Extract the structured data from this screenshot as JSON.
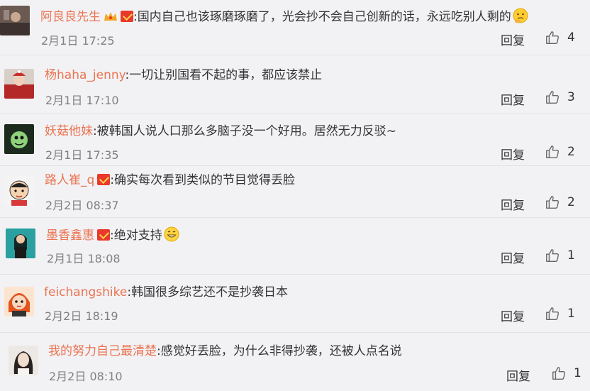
{
  "comments": [
    {
      "username": "阿良良先生",
      "colon": ":",
      "text": "国内自己也该琢磨琢磨了，光会抄不会自己创新的话，永远吃别人剩的",
      "time": "2月1日 17:25",
      "reply": "回复",
      "likes": "4",
      "avatar_icon": "avatar-photo-icon",
      "badges": [
        "crown-icon",
        "red-envelope-icon"
      ],
      "trailing_emoji": "thinking-face-icon"
    },
    {
      "username": "杨haha_jenny",
      "colon": ":",
      "text": "一切让别国看不起的事，都应该禁止",
      "time": "2月1日 17:10",
      "reply": "回复",
      "likes": "3",
      "avatar_icon": "avatar-photo-icon",
      "badges": [],
      "trailing_emoji": ""
    },
    {
      "username": "妖菇他妹",
      "colon": ":",
      "text": "被韩国人说人口那么多脑子没一个好用。居然无力反驳~",
      "time": "2月1日 17:35",
      "reply": "回复",
      "likes": "2",
      "avatar_icon": "avatar-photo-icon",
      "badges": [],
      "trailing_emoji": ""
    },
    {
      "username": "路人崔_q",
      "colon": ":",
      "text": "确实每次看到类似的节目觉得丢脸",
      "time": "2月2日 08:37",
      "reply": "回复",
      "likes": "2",
      "avatar_icon": "avatar-cartoon-icon",
      "badges": [
        "red-envelope-icon"
      ],
      "trailing_emoji": ""
    },
    {
      "username": "墨香鑫惠",
      "colon": ":",
      "text": "绝对支持",
      "time": "2月1日 18:08",
      "reply": "回复",
      "likes": "1",
      "avatar_icon": "avatar-photo-icon",
      "badges": [
        "red-envelope-icon"
      ],
      "trailing_emoji": "grin-face-icon"
    },
    {
      "username": "feichangshike",
      "colon": ":",
      "text": "韩国很多综艺还不是抄袭日本",
      "time": "2月2日 18:19",
      "reply": "回复",
      "likes": "1",
      "avatar_icon": "avatar-cartoon-icon",
      "badges": [],
      "trailing_emoji": ""
    },
    {
      "username": "我的努力自己最清楚",
      "colon": ":",
      "text": "感觉好丢脸，为什么非得抄袭，还被人点名说",
      "time": "2月2日 08:10",
      "reply": "回复",
      "likes": "1",
      "avatar_icon": "avatar-photo-icon",
      "badges": [],
      "trailing_emoji": ""
    }
  ],
  "colors": {
    "username": "#eb7350",
    "text": "#333333",
    "time": "#808080",
    "background": "#f2f2f5",
    "divider": "#e2e2e2"
  }
}
